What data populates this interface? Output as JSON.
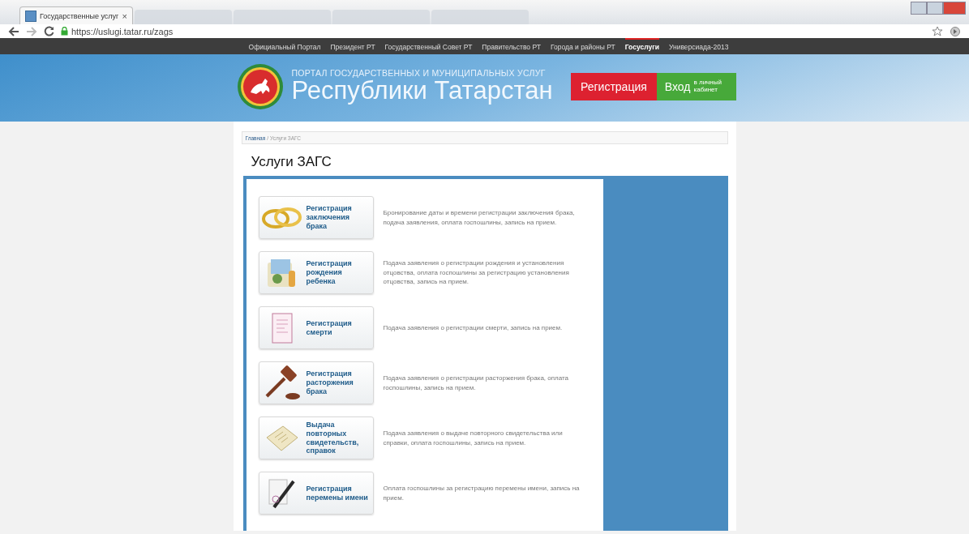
{
  "browser": {
    "tabs": [
      {
        "title": "Государственные услуг",
        "close": "×",
        "selected": true
      },
      {
        "selected": false
      },
      {
        "selected": false
      },
      {
        "selected": false
      },
      {
        "selected": false
      }
    ],
    "url": "https://uslugi.tatar.ru/zags"
  },
  "top_nav": [
    {
      "label": "Официальный Портал",
      "selected": false
    },
    {
      "label": "Президент РТ",
      "selected": false
    },
    {
      "label": "Государственный Совет РТ",
      "selected": false
    },
    {
      "label": "Правительство РТ",
      "selected": false
    },
    {
      "label": "Города и районы РТ",
      "selected": false
    },
    {
      "label": "Госуслуги",
      "selected": true
    },
    {
      "label": "Универсиада-2013",
      "selected": false
    }
  ],
  "header": {
    "subtitle": "ПОРТАЛ ГОСУДАРСТВЕННЫХ И МУНИЦИПАЛЬНЫХ УСЛУГ",
    "title": "Республики Татарстан",
    "register_button": "Регистрация",
    "login_button": "Вход",
    "login_note": "в личный кабинет"
  },
  "breadcrumb": {
    "home": "Главная",
    "separator": "/",
    "current": "Услуги ЗАГС"
  },
  "page_title": "Услуги ЗАГС",
  "services": [
    {
      "title": "Регистрация заключения брака",
      "description": "Бронирование даты и времени регистрации заключения брака, подача заявления, оплата госпошлины, запись на прием."
    },
    {
      "title": "Регистрация рождения ребенка",
      "description": "Подача заявления о регистрации рождения и установления отцовства, оплата госпошлины за регистрацию установления отцовства, запись на прием."
    },
    {
      "title": "Регистрация смерти",
      "description": "Подача заявления о регистрации смерти, запись на прием."
    },
    {
      "title": "Регистрация расторжения брака",
      "description": "Подача заявления о регистрации расторжения брака, оплата госпошлины, запись на прием."
    },
    {
      "title": "Выдача повторных свидетельств, справок",
      "description": "Подача заявления о выдаче повторного свидетельства или справки, оплата госпошлины, запись на прием."
    },
    {
      "title": "Регистрация перемены имени",
      "description": "Оплата госпошлины за регистрацию перемены имени, запись на прием."
    }
  ]
}
